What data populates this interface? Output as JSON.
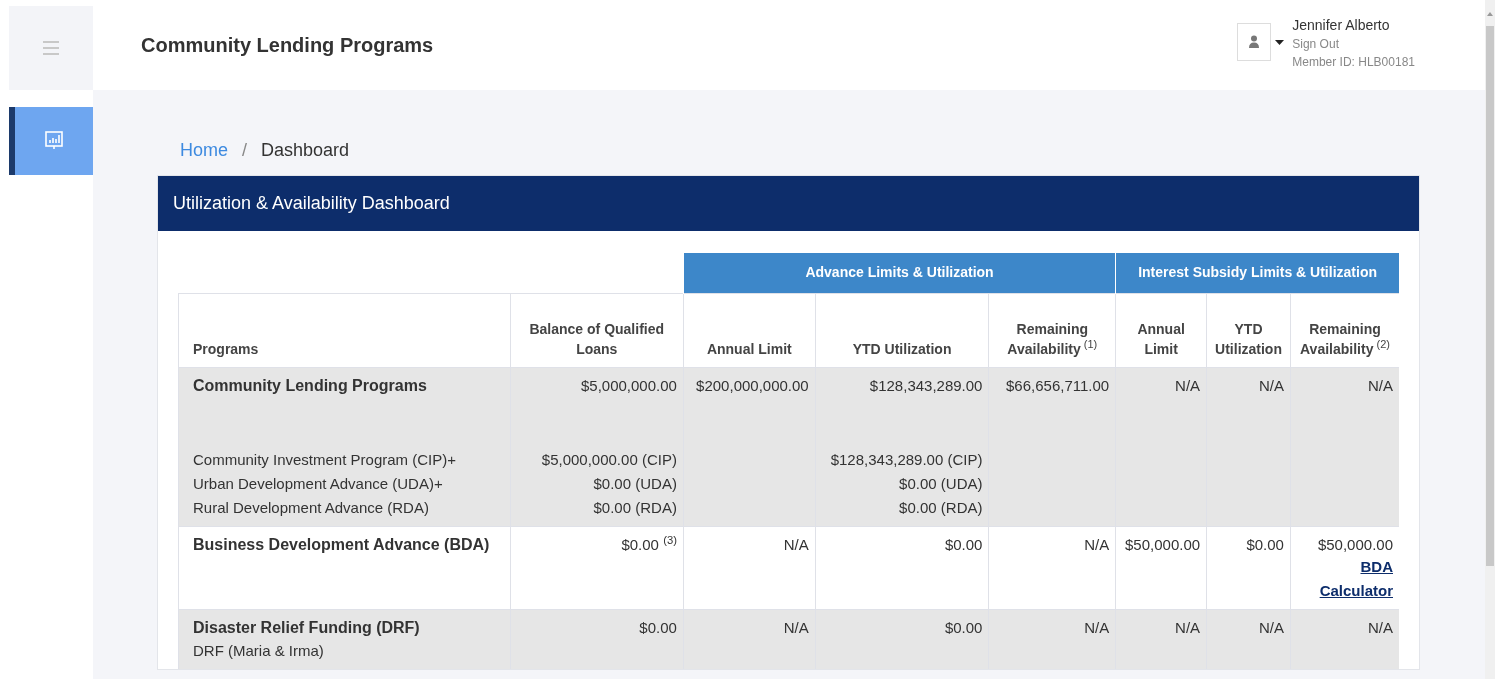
{
  "header": {
    "title": "Community Lending Programs",
    "user": {
      "name": "Jennifer Alberto",
      "sign_out": "Sign Out",
      "member_id": "Member ID: HLB00181"
    }
  },
  "sidebar": {
    "items": [
      {
        "selected": true
      }
    ]
  },
  "breadcrumb": {
    "separator": "/",
    "items": [
      {
        "label": "Home",
        "kind": "link"
      },
      {
        "label": "Dashboard",
        "kind": "current"
      }
    ]
  },
  "card": {
    "title": "Utilization & Availability Dashboard"
  },
  "table": {
    "groups": [
      {
        "label": "Advance Limits & Utilization"
      },
      {
        "label": "Interest Subsidy Limits & Utilization"
      }
    ],
    "columns": [
      {
        "label": "Programs"
      },
      {
        "label": "Balance of Qualified Loans"
      },
      {
        "label": "Annual Limit"
      },
      {
        "label": "YTD Utilization"
      },
      {
        "label": "Remaining Availability",
        "note": "(1)"
      },
      {
        "label": "Annual Limit"
      },
      {
        "label": "YTD Utilization"
      },
      {
        "label": "Remaining Availability",
        "note": "(2)"
      }
    ],
    "rows": [
      {
        "kind": "summary",
        "cells": [
          {
            "value": "Community Lending Programs",
            "lines": [
              "Community Investment Program (CIP)+",
              "Urban Development Advance (UDA)+",
              "Rural Development Advance (RDA)"
            ]
          },
          {
            "value": "$5,000,000.00",
            "lines": [
              "$5,000,000.00 (CIP)",
              "$0.00 (UDA)",
              "$0.00 (RDA)"
            ]
          },
          {
            "value": "$200,000,000.00"
          },
          {
            "value": "$128,343,289.00",
            "lines": [
              "$128,343,289.00 (CIP)",
              "$0.00 (UDA)",
              "$0.00 (RDA)"
            ]
          },
          {
            "value": "$66,656,711.00"
          },
          {
            "value": "N/A"
          },
          {
            "value": "N/A"
          },
          {
            "value": "N/A"
          }
        ]
      },
      {
        "kind": "plain",
        "cells": [
          {
            "value": "Business Development Advance (BDA)"
          },
          {
            "value": "$0.00 $^{(3)}$"
          },
          {
            "value": "N/A"
          },
          {
            "value": "$0.00"
          },
          {
            "value": "N/A"
          },
          {
            "value": "$50,000.00"
          },
          {
            "value": "$0.00"
          },
          {
            "value": "$50,000.00",
            "link": "BDA Calculator"
          }
        ]
      },
      {
        "kind": "plain",
        "cells": [
          {
            "value": "Disaster Relief Funding (DRF)",
            "lines": [
              "DRF (Maria & Irma)"
            ]
          },
          {
            "value": "$0.00"
          },
          {
            "value": "N/A"
          },
          {
            "value": "$0.00"
          },
          {
            "value": "N/A"
          },
          {
            "value": "N/A"
          },
          {
            "value": "N/A"
          },
          {
            "value": "N/A"
          }
        ]
      }
    ]
  }
}
